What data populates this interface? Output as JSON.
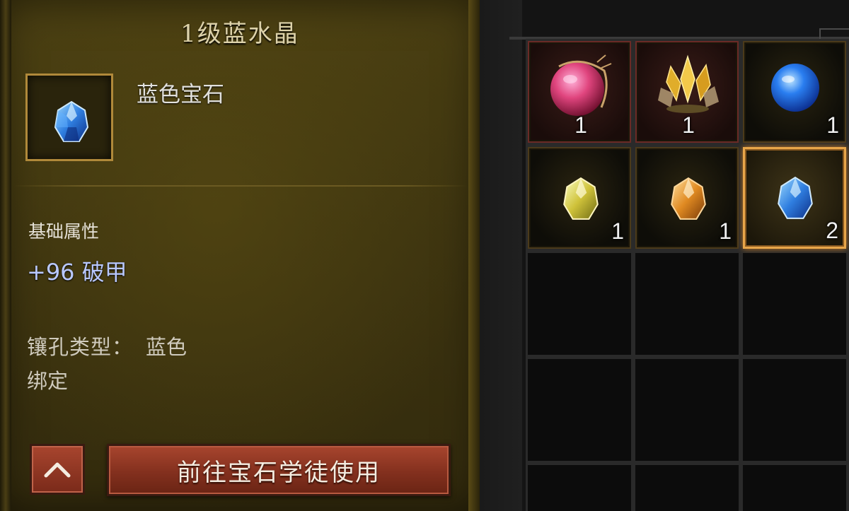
{
  "tooltip": {
    "title": "1级蓝水晶",
    "item_icon": "blue-gem-icon",
    "item_type": "蓝色宝石",
    "stat_heading": "基础属性",
    "stat_value": "+96 破甲",
    "socket_label": "镶孔类型：",
    "socket_value": "蓝色",
    "bind_status": "绑定",
    "collapse_icon": "chevron-up-icon",
    "goto_button_label": "前往宝石学徒使用",
    "colors": {
      "stat_blue": "#b9c8ff",
      "button_red": "#a8452e",
      "frame_gold": "#b0893a"
    }
  },
  "inventory": {
    "slots": [
      {
        "icon": "red-orb-icon",
        "count": "1"
      },
      {
        "icon": "gold-crystal-cluster-icon",
        "count": "1"
      },
      {
        "icon": "blue-orb-icon",
        "count": "1"
      },
      {
        "icon": "yellow-gem-icon",
        "count": "1"
      },
      {
        "icon": "orange-gem-icon",
        "count": "1"
      },
      {
        "icon": "blue-gem-icon",
        "count": "2",
        "selected": true
      }
    ],
    "empty_slots": 9,
    "colors": {
      "selected_border": "#e8a64a"
    }
  }
}
